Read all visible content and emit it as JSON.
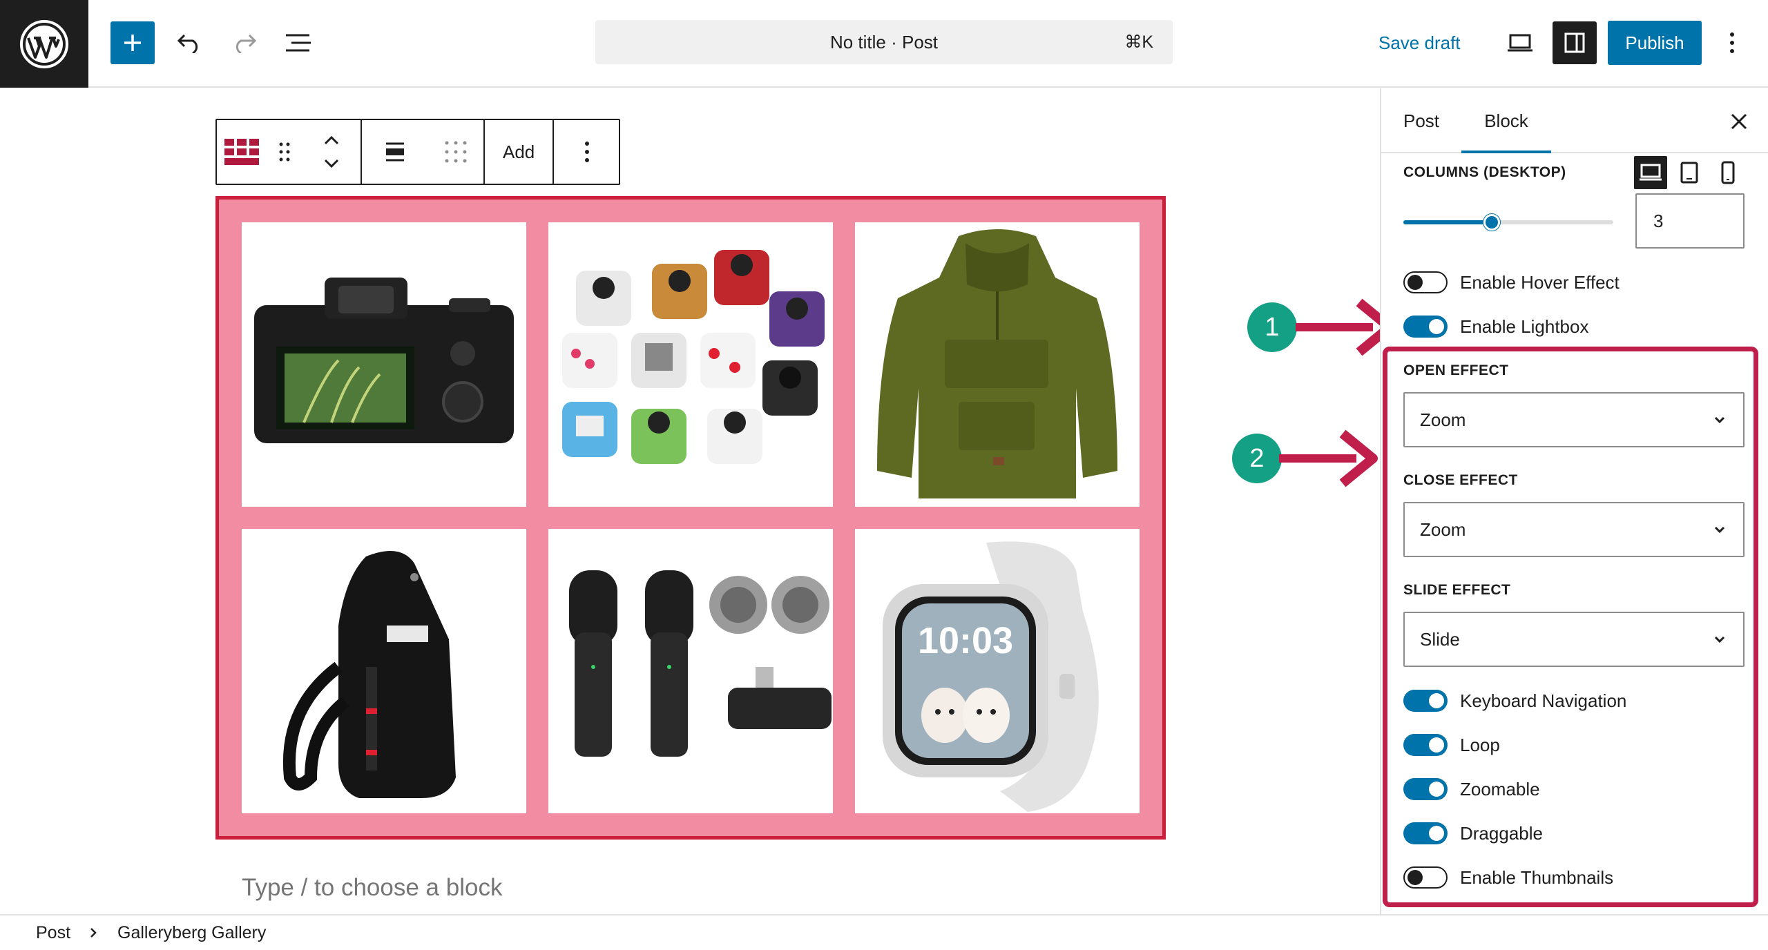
{
  "topbar": {
    "doc_title": "No title · Post",
    "shortcut": "⌘K",
    "save_draft": "Save draft",
    "publish": "Publish"
  },
  "block_toolbar": {
    "add_label": "Add"
  },
  "gallery": {
    "items": [
      "camera",
      "fidget-cubes",
      "olive-hoodie",
      "sling-bag",
      "wireless-microphones",
      "smartwatch"
    ]
  },
  "canvas": {
    "placeholder": "Type / to choose a block"
  },
  "annotations": {
    "badge_1": "1",
    "badge_2": "2",
    "accent": "#c01f4b",
    "badge_color": "#14a085"
  },
  "sidebar": {
    "tab_post": "Post",
    "tab_block": "Block",
    "columns_label": "COLUMNS (DESKTOP)",
    "columns_value": "3",
    "columns_slider_fraction": 0.42,
    "toggles": {
      "hover": {
        "label": "Enable Hover Effect",
        "on": false
      },
      "lightbox": {
        "label": "Enable Lightbox",
        "on": true
      },
      "keyboard": {
        "label": "Keyboard Navigation",
        "on": true
      },
      "loop": {
        "label": "Loop",
        "on": true
      },
      "zoomable": {
        "label": "Zoomable",
        "on": true
      },
      "draggable": {
        "label": "Draggable",
        "on": true
      },
      "thumbnails": {
        "label": "Enable Thumbnails",
        "on": false
      }
    },
    "open_effect_label": "OPEN EFFECT",
    "open_effect_value": "Zoom",
    "close_effect_label": "CLOSE EFFECT",
    "close_effect_value": "Zoom",
    "slide_effect_label": "SLIDE EFFECT",
    "slide_effect_value": "Slide"
  },
  "footer": {
    "crumb_1": "Post",
    "crumb_2": "Galleryberg Gallery"
  },
  "colors": {
    "primary": "#0073aa",
    "gallery_bg": "#f28ca3",
    "gallery_border": "#cc1f3b"
  }
}
